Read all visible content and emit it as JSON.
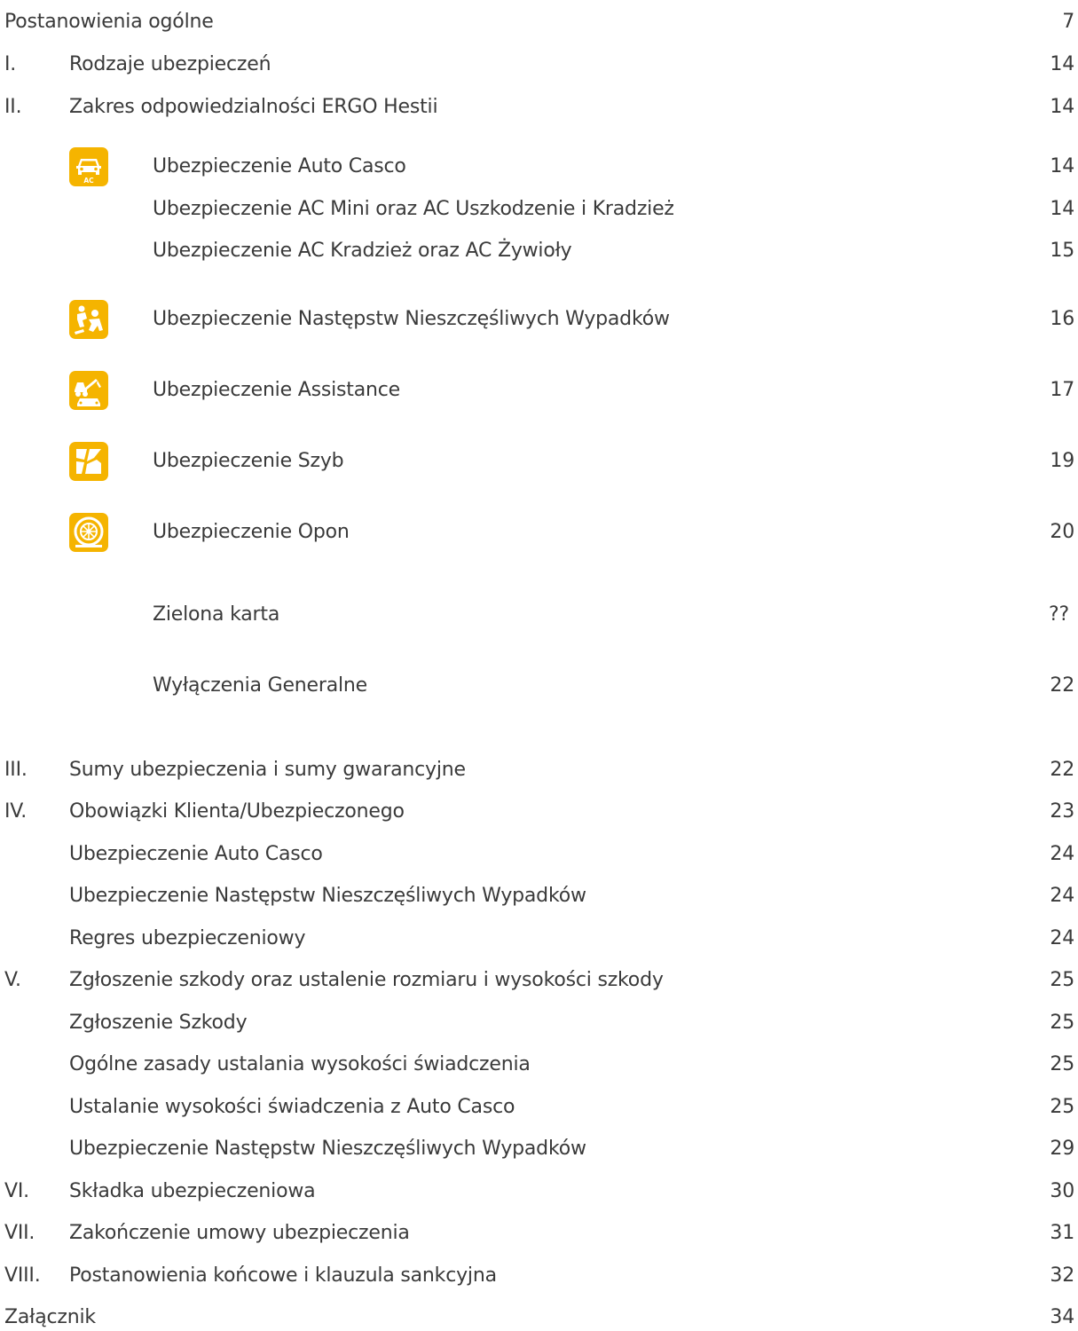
{
  "toc": {
    "r01": {
      "label": "Postanowienia ogólne",
      "page": "7"
    },
    "r02": {
      "num": "I.",
      "label": "Rodzaje ubezpieczeń",
      "page": "14"
    },
    "r03": {
      "num": "II.",
      "label": "Zakres odpowiedzialności ERGO Hestii",
      "page": "14"
    },
    "r04": {
      "label": "Ubezpieczenie Auto Casco",
      "page": "14"
    },
    "r05": {
      "label": "Ubezpieczenie AC Mini oraz AC Uszkodzenie i Kradzież",
      "page": "14"
    },
    "r06": {
      "label": "Ubezpieczenie AC Kradzież oraz AC Żywioły",
      "page": "15"
    },
    "r07": {
      "label": "Ubezpieczenie Następstw Nieszczęśliwych Wypadków",
      "page": "16"
    },
    "r08": {
      "label": "Ubezpieczenie Assistance",
      "page": "17"
    },
    "r09": {
      "label": "Ubezpieczenie Szyb",
      "page": "19"
    },
    "r10": {
      "label": "Ubezpieczenie Opon",
      "page": "20"
    },
    "r11": {
      "label": "Zielona karta",
      "page": "??"
    },
    "r12": {
      "label": "Wyłączenia Generalne",
      "page": "22"
    },
    "r13": {
      "num": "III.",
      "label": "Sumy ubezpieczenia i sumy gwarancyjne",
      "page": "22"
    },
    "r14": {
      "num": "IV.",
      "label": "Obowiązki Klienta/Ubezpieczonego",
      "page": "23"
    },
    "r15": {
      "label": "Ubezpieczenie Auto Casco",
      "page": "24"
    },
    "r16": {
      "label": "Ubezpieczenie Następstw Nieszczęśliwych Wypadków",
      "page": "24"
    },
    "r17": {
      "label": "Regres ubezpieczeniowy",
      "page": "24"
    },
    "r18": {
      "num": "V.",
      "label": "Zgłoszenie szkody oraz ustalenie rozmiaru i wysokości szkody",
      "page": "25"
    },
    "r19": {
      "label": "Zgłoszenie Szkody",
      "page": "25"
    },
    "r20": {
      "label": "Ogólne zasady ustalania wysokości świadczenia",
      "page": "25"
    },
    "r21": {
      "label": "Ustalanie wysokości świadczenia z Auto Casco",
      "page": "25"
    },
    "r22": {
      "label": "Ubezpieczenie Następstw Nieszczęśliwych Wypadków",
      "page": "29"
    },
    "r23": {
      "num": "VI.",
      "label": "Składka ubezpieczeniowa",
      "page": "30"
    },
    "r24": {
      "num": "VII.",
      "label": "Zakończenie umowy ubezpieczenia",
      "page": "31"
    },
    "r25": {
      "num": "VIII.",
      "label": "Postanowienia końcowe i klauzula sankcyjna",
      "page": "32"
    },
    "r26": {
      "label": "Załącznik",
      "page": "34"
    }
  },
  "icons": {
    "auto_casco": {
      "name": "car-ac-icon",
      "badge": "AC"
    },
    "nnw": {
      "name": "injured-people-icon"
    },
    "assistance": {
      "name": "tow-truck-icon"
    },
    "szyby": {
      "name": "broken-glass-icon"
    },
    "opony": {
      "name": "tire-icon"
    }
  },
  "colors": {
    "text": "#3a3a3a",
    "icon_bg": "#f5b400",
    "icon_fg": "#ffffff"
  }
}
